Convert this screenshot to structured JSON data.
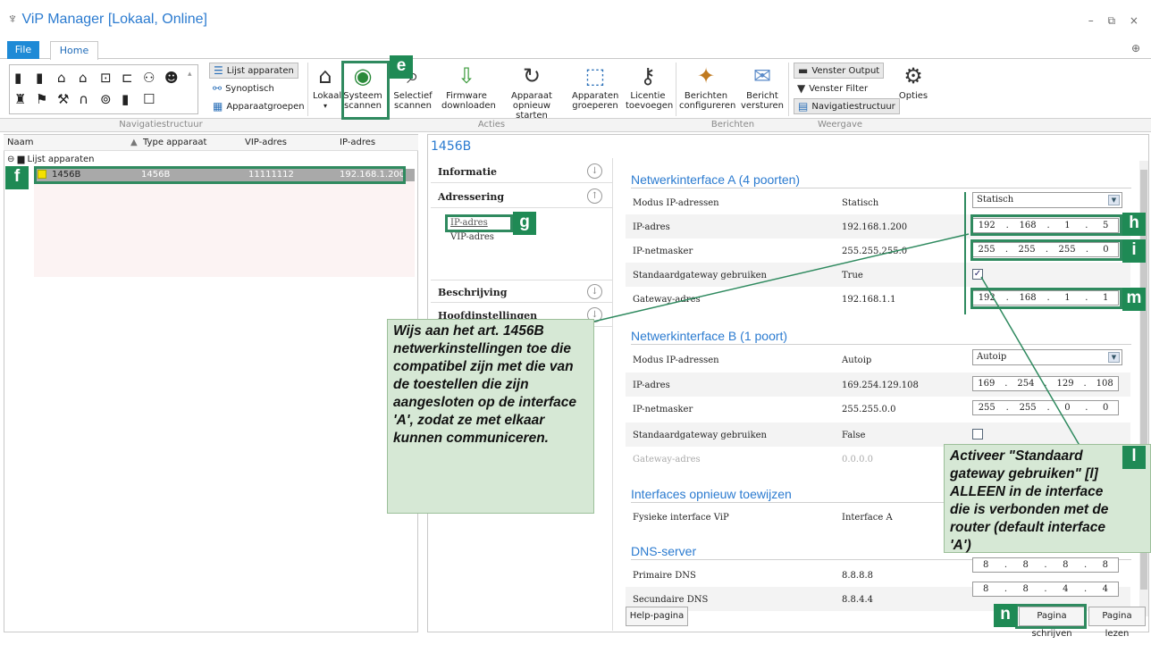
{
  "app": {
    "title": "ViP Manager [Lokaal, Online]",
    "window_controls": "– ⧉ ×"
  },
  "tabs": {
    "file": "File",
    "home": "Home"
  },
  "ribbon": {
    "list_items": [
      "Lijst apparaten",
      "Synoptisch",
      "Apparaatgroepen"
    ],
    "lokaal": "Lokaal",
    "systeem_scannen": [
      "Systeem",
      "scannen"
    ],
    "selectief_scannen": [
      "Selectief",
      "scannen"
    ],
    "firmware": [
      "Firmware",
      "downloaden"
    ],
    "herstart": [
      "Apparaat",
      "opnieuw starten"
    ],
    "groeperen": [
      "Apparaten",
      "groeperen"
    ],
    "licentie": [
      "Licentie",
      "toevoegen"
    ],
    "berichten_conf": [
      "Berichten",
      "configureren"
    ],
    "bericht_verst": [
      "Bericht",
      "versturen"
    ],
    "weergave": [
      "Venster Output",
      "Venster Filter",
      "Navigatiestructuur"
    ],
    "opties": "Opties",
    "groups": [
      "Navigatiestructuur",
      "Acties",
      "Berichten",
      "Weergave"
    ]
  },
  "left": {
    "columns": [
      "Naam",
      "Type apparaat",
      "VIP-adres",
      "IP-adres"
    ],
    "root": "Lijst apparaten",
    "device": {
      "name": "1456B",
      "type": "1456B",
      "vip": "11111112",
      "ip": "192.168.1.200"
    }
  },
  "right": {
    "title": "1456B",
    "nav": {
      "informatie": "Informatie",
      "adressering": "Adressering",
      "ip_adres": "IP-adres",
      "vip_adres": "VIP-adres",
      "beschrijving": "Beschrijving",
      "hoofd": "Hoofdinstellingen"
    },
    "netA": {
      "title": "Netwerkinterface A (4 poorten)",
      "mode_k": "Modus IP-adressen",
      "mode_v": "Statisch",
      "mode_sel": "Statisch",
      "ip_k": "IP-adres",
      "ip_v": "192.168.1.200",
      "ip": [
        "192",
        "168",
        "1",
        "5"
      ],
      "mask_k": "IP-netmasker",
      "mask_v": "255.255.255.0",
      "mask": [
        "255",
        "255",
        "255",
        "0"
      ],
      "gw_use_k": "Standaardgateway gebruiken",
      "gw_use_v": "True",
      "gw_k": "Gateway-adres",
      "gw_v": "192.168.1.1",
      "gw": [
        "192",
        "168",
        "1",
        "1"
      ]
    },
    "netB": {
      "title": "Netwerkinterface B (1 poort)",
      "mode_k": "Modus IP-adressen",
      "mode_v": "Autoip",
      "mode_sel": "Autoip",
      "ip_k": "IP-adres",
      "ip_v": "169.254.129.108",
      "ip": [
        "169",
        "254",
        "129",
        "108"
      ],
      "mask_k": "IP-netmasker",
      "mask_v": "255.255.0.0",
      "mask": [
        "255",
        "255",
        "0",
        "0"
      ],
      "gw_use_k": "Standaardgateway gebruiken",
      "gw_use_v": "False",
      "gw_k": "Gateway-adres",
      "gw_v": "0.0.0.0"
    },
    "reassign": {
      "title": "Interfaces opnieuw toewijzen",
      "k": "Fysieke interface ViP",
      "v": "Interface A"
    },
    "dns": {
      "title": "DNS-server",
      "p_k": "Primaire DNS",
      "p_v": "8.8.8.8",
      "p": [
        "8",
        "8",
        "8",
        "8"
      ],
      "s_k": "Secundaire DNS",
      "s_v": "8.8.4.4",
      "s": [
        "8",
        "8",
        "4",
        "4"
      ]
    },
    "buttons": {
      "help": "Help-pagina",
      "write": "Pagina schrijven",
      "read": "Pagina lezen"
    }
  },
  "callouts": {
    "left": "Wijs aan het art. 1456B netwerkinstellingen toe die compatibel zijn met die van de toestellen die zijn aangesloten op de interface 'A', zodat ze met elkaar kunnen communiceren.",
    "right": "Activeer \"Standaard gateway gebruiken\" [l] ALLEEN in de interface die is verbonden met de router (default interface 'A')"
  },
  "tags": {
    "e": "e",
    "f": "f",
    "g": "g",
    "h": "h",
    "i": "i",
    "m": "m",
    "l": "l",
    "n": "n"
  },
  "colors": {
    "accent": "#2b7bd0",
    "highlight": "#2f8a5f",
    "callout_bg": "#d6e8d5"
  }
}
